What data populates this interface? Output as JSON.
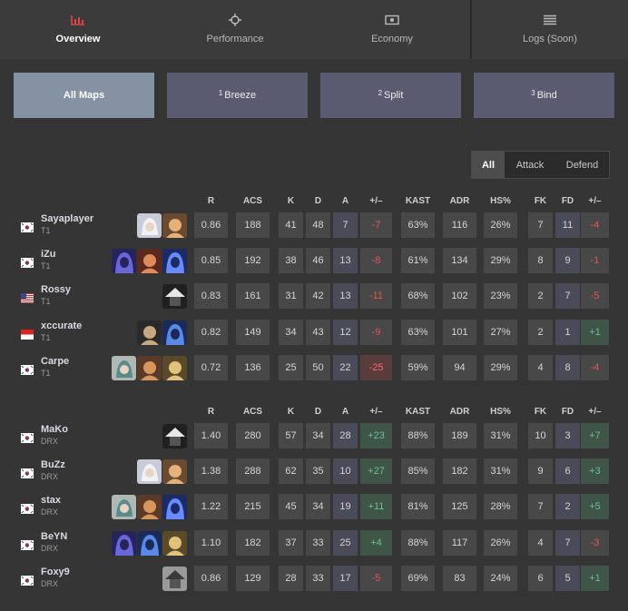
{
  "topnav": {
    "tabs": [
      {
        "label": "Overview",
        "icon": "chart-bars-icon",
        "active": true
      },
      {
        "label": "Performance",
        "icon": "crosshair-icon",
        "active": false
      },
      {
        "label": "Economy",
        "icon": "money-icon",
        "active": false
      },
      {
        "label": "Logs (Soon)",
        "icon": "list-icon",
        "active": false
      }
    ]
  },
  "maps": [
    {
      "num": "",
      "label": "All Maps",
      "active": true
    },
    {
      "num": "1",
      "label": "Breeze",
      "active": false
    },
    {
      "num": "2",
      "label": "Split",
      "active": false
    },
    {
      "num": "3",
      "label": "Bind",
      "active": false
    }
  ],
  "side_filter": [
    "All",
    "Attack",
    "Defend"
  ],
  "columns": [
    "R",
    "ACS",
    "K",
    "D",
    "A",
    "+/–",
    "KAST",
    "ADR",
    "HS%",
    "FK",
    "FD",
    "+/–"
  ],
  "teams": [
    {
      "players": [
        {
          "name": "Sayaplayer",
          "team": "T1",
          "flag": "kr",
          "agents": [
            "jett",
            "raze"
          ],
          "stats": [
            "0.86",
            "188",
            "41",
            "48",
            "7",
            "-7",
            "63%",
            "116",
            "26%",
            "7",
            "11",
            "-4"
          ]
        },
        {
          "name": "iZu",
          "team": "T1",
          "flag": "kr",
          "agents": [
            "omen",
            "phoenix",
            "yoru"
          ],
          "stats": [
            "0.85",
            "192",
            "38",
            "46",
            "13",
            "-8",
            "61%",
            "134",
            "29%",
            "8",
            "9",
            "-1"
          ]
        },
        {
          "name": "Rossy",
          "team": "T1",
          "flag": "us",
          "agents": [
            "cypher"
          ],
          "stats": [
            "0.83",
            "161",
            "31",
            "42",
            "13",
            "-11",
            "68%",
            "102",
            "23%",
            "2",
            "7",
            "-5"
          ]
        },
        {
          "name": "xccurate",
          "team": "T1",
          "flag": "id",
          "agents": [
            "killjoy",
            "chamber"
          ],
          "stats": [
            "0.82",
            "149",
            "34",
            "43",
            "12",
            "-9",
            "63%",
            "101",
            "27%",
            "2",
            "1",
            "+1"
          ]
        },
        {
          "name": "Carpe",
          "team": "T1",
          "flag": "kr",
          "agents": [
            "sage",
            "skye",
            "sova"
          ],
          "stats": [
            "0.72",
            "136",
            "25",
            "50",
            "22",
            "-25",
            "59%",
            "94",
            "29%",
            "4",
            "8",
            "-4"
          ]
        }
      ]
    },
    {
      "players": [
        {
          "name": "MaKo",
          "team": "DRX",
          "flag": "kr",
          "agents": [
            "cypher"
          ],
          "stats": [
            "1.40",
            "280",
            "57",
            "34",
            "28",
            "+23",
            "88%",
            "189",
            "31%",
            "10",
            "3",
            "+7"
          ]
        },
        {
          "name": "BuZz",
          "team": "DRX",
          "flag": "kr",
          "agents": [
            "jett",
            "raze"
          ],
          "stats": [
            "1.38",
            "288",
            "62",
            "35",
            "10",
            "+27",
            "85%",
            "182",
            "31%",
            "9",
            "6",
            "+3"
          ]
        },
        {
          "name": "stax",
          "team": "DRX",
          "flag": "kr",
          "agents": [
            "sage",
            "skye",
            "yoru"
          ],
          "stats": [
            "1.22",
            "215",
            "45",
            "34",
            "19",
            "+11",
            "81%",
            "125",
            "28%",
            "7",
            "2",
            "+5"
          ]
        },
        {
          "name": "BeYN",
          "team": "DRX",
          "flag": "kr",
          "agents": [
            "omen",
            "chamber",
            "sova"
          ],
          "stats": [
            "1.10",
            "182",
            "37",
            "33",
            "25",
            "+4",
            "88%",
            "117",
            "26%",
            "4",
            "7",
            "-3"
          ]
        },
        {
          "name": "Foxy9",
          "team": "DRX",
          "flag": "kr",
          "agents": [
            "viper"
          ],
          "stats": [
            "0.86",
            "129",
            "28",
            "33",
            "17",
            "-5",
            "69%",
            "83",
            "24%",
            "6",
            "5",
            "+1"
          ]
        }
      ]
    }
  ],
  "colors": {
    "background": "#353535",
    "cell": "#484848",
    "positive": "#72c08a",
    "negative": "#e05656",
    "map_active": "#8592a3",
    "map": "#5a5a70"
  }
}
